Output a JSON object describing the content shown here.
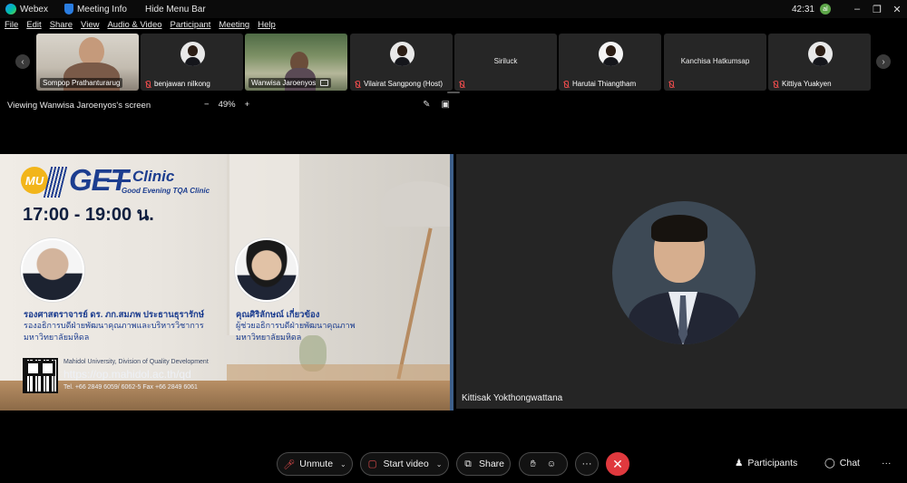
{
  "titlebar": {
    "app_name": "Webex",
    "meeting_info": "Meeting Info",
    "hide_menu": "Hide Menu Bar",
    "clock": "42:31",
    "user_initials": "al"
  },
  "menu": [
    "File",
    "Edit",
    "Share",
    "View",
    "Audio & Video",
    "Participant",
    "Meeting",
    "Help"
  ],
  "participants": [
    {
      "name": "Sompop Prathanturarug",
      "video": true,
      "muted": false
    },
    {
      "name": "benjawan nilkong",
      "video": false,
      "muted": true
    },
    {
      "name": "Wanwisa Jaroenyos",
      "video": true,
      "muted": false,
      "sharing": true
    },
    {
      "name": "Vilairat Sangpong (Host)",
      "video": false,
      "muted": true
    },
    {
      "name": "Siriluck",
      "video": false,
      "muted": true
    },
    {
      "name": "Harutai Thiangtham",
      "video": false,
      "muted": true
    },
    {
      "name": "Kanchisa Hatkumsap",
      "video": false,
      "muted": true
    },
    {
      "name": "Kittiya Yuakyen",
      "video": false,
      "muted": true
    }
  ],
  "share": {
    "title": "Viewing Wanwisa Jaroenyos's screen",
    "zoom_minus": "−",
    "zoom_level": "49%",
    "zoom_plus": "+"
  },
  "slide": {
    "logo_mu": "MU",
    "logo_get": "GET",
    "logo_clinic": "Clinic",
    "logo_sub": "Good Evening TQA Clinic",
    "time": "17:00 - 19:00 น.",
    "speaker1_name": "รองศาสตราจารย์ ดร. ภก.สมภพ ประธานธุรารักษ์",
    "speaker1_role1": "รองอธิการบดีฝ่ายพัฒนาคุณภาพและบริหารวิชาการ",
    "speaker1_role2": "มหาวิทยาลัยมหิดล",
    "speaker2_name": "คุณศิริลักษณ์ เกี่ยวข้อง",
    "speaker2_role1": "ผู้ช่วยอธิการบดีฝ่ายพัฒนาคุณภาพ",
    "speaker2_role2": "มหาวิทยาลัยมหิดล",
    "org": "Mahidol University, Division of Quality Development",
    "url": "https://op.mahidol.ac.th/qd",
    "tel": "Tel. +66 2849 6059/ 6062-5 Fax +66 2849 6061"
  },
  "active_speaker": {
    "name": "Kittisak Yokthongwattana"
  },
  "controls": {
    "unmute": "Unmute",
    "start_video": "Start video",
    "share": "Share",
    "more": "···",
    "end": "✕",
    "participants": "Participants",
    "chat": "Chat",
    "overflow": "···"
  }
}
